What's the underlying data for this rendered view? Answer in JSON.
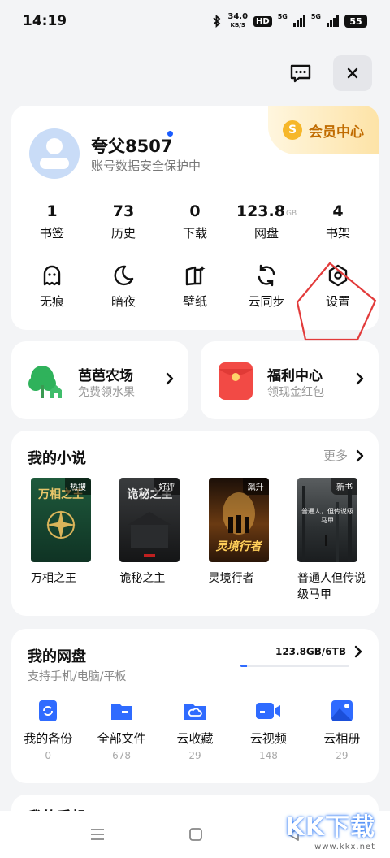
{
  "status_bar": {
    "time": "14:19",
    "speed_value": "34.0",
    "speed_unit": "KB/S",
    "hd": "HD",
    "net1": "5G",
    "net2": "5G",
    "battery": "55"
  },
  "top_actions": {
    "message_icon": "message-icon",
    "close_icon": "close-icon"
  },
  "profile": {
    "name": "夸父8507",
    "subtitle": "账号数据安全保护中",
    "vip_label": "会员中心",
    "vip_coin": "S"
  },
  "stats": [
    {
      "value": "1",
      "unit": "",
      "label": "书签"
    },
    {
      "value": "73",
      "unit": "",
      "label": "历史"
    },
    {
      "value": "0",
      "unit": "",
      "label": "下载"
    },
    {
      "value": "123.8",
      "unit": "GB",
      "label": "网盘"
    },
    {
      "value": "4",
      "unit": "",
      "label": "书架"
    }
  ],
  "tools": [
    {
      "label": "无痕",
      "icon": "ghost-icon"
    },
    {
      "label": "暗夜",
      "icon": "moon-icon"
    },
    {
      "label": "壁纸",
      "icon": "wallpaper-icon"
    },
    {
      "label": "云同步",
      "icon": "sync-icon"
    },
    {
      "label": "设置",
      "icon": "settings-icon"
    }
  ],
  "promos": [
    {
      "title": "芭芭农场",
      "subtitle": "免费领水果",
      "icon": "tree-icon"
    },
    {
      "title": "福利中心",
      "subtitle": "领现金红包",
      "icon": "red-envelope-icon"
    }
  ],
  "novels": {
    "title": "我的小说",
    "more": "更多",
    "books": [
      {
        "title": "万相之王",
        "badge": "热搜",
        "cover_text": "万相之王"
      },
      {
        "title": "诡秘之主",
        "badge": "好评",
        "cover_text": "诡秘之主"
      },
      {
        "title": "灵境行者",
        "badge": "飙升",
        "cover_text": "灵境行者"
      },
      {
        "title": "普通人但传说级马甲",
        "badge": "新书",
        "cover_text": "普通人，但传说级马甲"
      }
    ]
  },
  "disk": {
    "title": "我的网盘",
    "subtitle": "支持手机/电脑/平板",
    "quota": "123.8GB/6TB",
    "used_fraction": 0.02,
    "items": [
      {
        "label": "我的备份",
        "count": "0",
        "icon": "backup-icon"
      },
      {
        "label": "全部文件",
        "count": "678",
        "icon": "folder-icon"
      },
      {
        "label": "云收藏",
        "count": "29",
        "icon": "cloud-folder-icon"
      },
      {
        "label": "云视频",
        "count": "148",
        "icon": "video-icon"
      },
      {
        "label": "云相册",
        "count": "29",
        "icon": "photo-icon"
      }
    ]
  },
  "next_section": {
    "title": "我的手机"
  },
  "watermark": {
    "main": "KK下载",
    "url": "www.kkx.net"
  },
  "colors": {
    "accent": "#2f6bff",
    "vip": "#c06b00",
    "highlight": "#e23b3b"
  }
}
